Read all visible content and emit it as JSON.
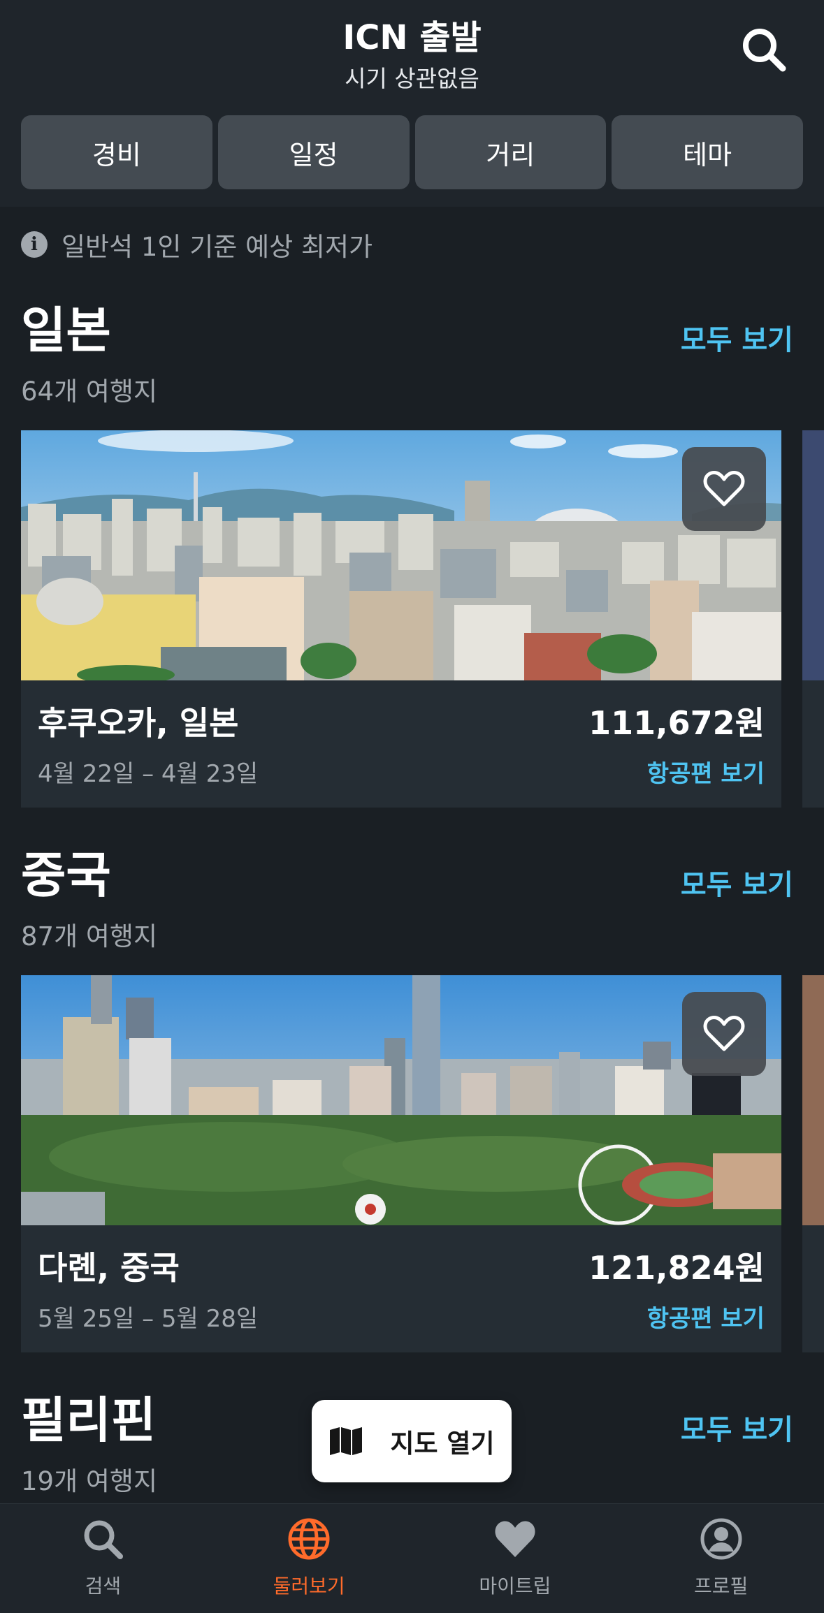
{
  "header": {
    "title": "ICN 출발",
    "subtitle": "시기 상관없음",
    "search_icon": "search-icon",
    "filters": [
      "경비",
      "일정",
      "거리",
      "테마"
    ]
  },
  "info": {
    "icon": "info-icon",
    "text": "일반석 1인 기준 예상 최저가"
  },
  "sections": [
    {
      "title": "일본",
      "count": "64개 여행지",
      "see_all": "모두 보기",
      "card": {
        "city": "후쿠오카, 일본",
        "dates": "4월 22일 – 4월 23일",
        "price": "111,672원",
        "flight_link": "항공편 보기"
      }
    },
    {
      "title": "중국",
      "count": "87개 여행지",
      "see_all": "모두 보기",
      "card": {
        "city": "다롄, 중국",
        "dates": "5월 25일 – 5월 28일",
        "price": "121,824원",
        "flight_link": "항공편 보기"
      }
    },
    {
      "title": "필리핀",
      "count": "19개 여행지",
      "see_all": "모두 보기"
    }
  ],
  "map_button": {
    "label": "지도 열기",
    "icon": "map-icon"
  },
  "bottom_nav": {
    "items": [
      {
        "label": "검색",
        "icon": "search-icon",
        "active": false
      },
      {
        "label": "둘러보기",
        "icon": "globe-icon",
        "active": true
      },
      {
        "label": "마이트립",
        "icon": "heart-icon",
        "active": false
      },
      {
        "label": "프로필",
        "icon": "profile-icon",
        "active": false
      }
    ]
  },
  "colors": {
    "background": "#1a1f24",
    "header_bg": "#1f252b",
    "chip_bg": "#444b52",
    "card_bg": "#252d34",
    "link": "#4fc4f2",
    "active_nav": "#ff6b2b",
    "muted_text": "#a2a8ae"
  }
}
